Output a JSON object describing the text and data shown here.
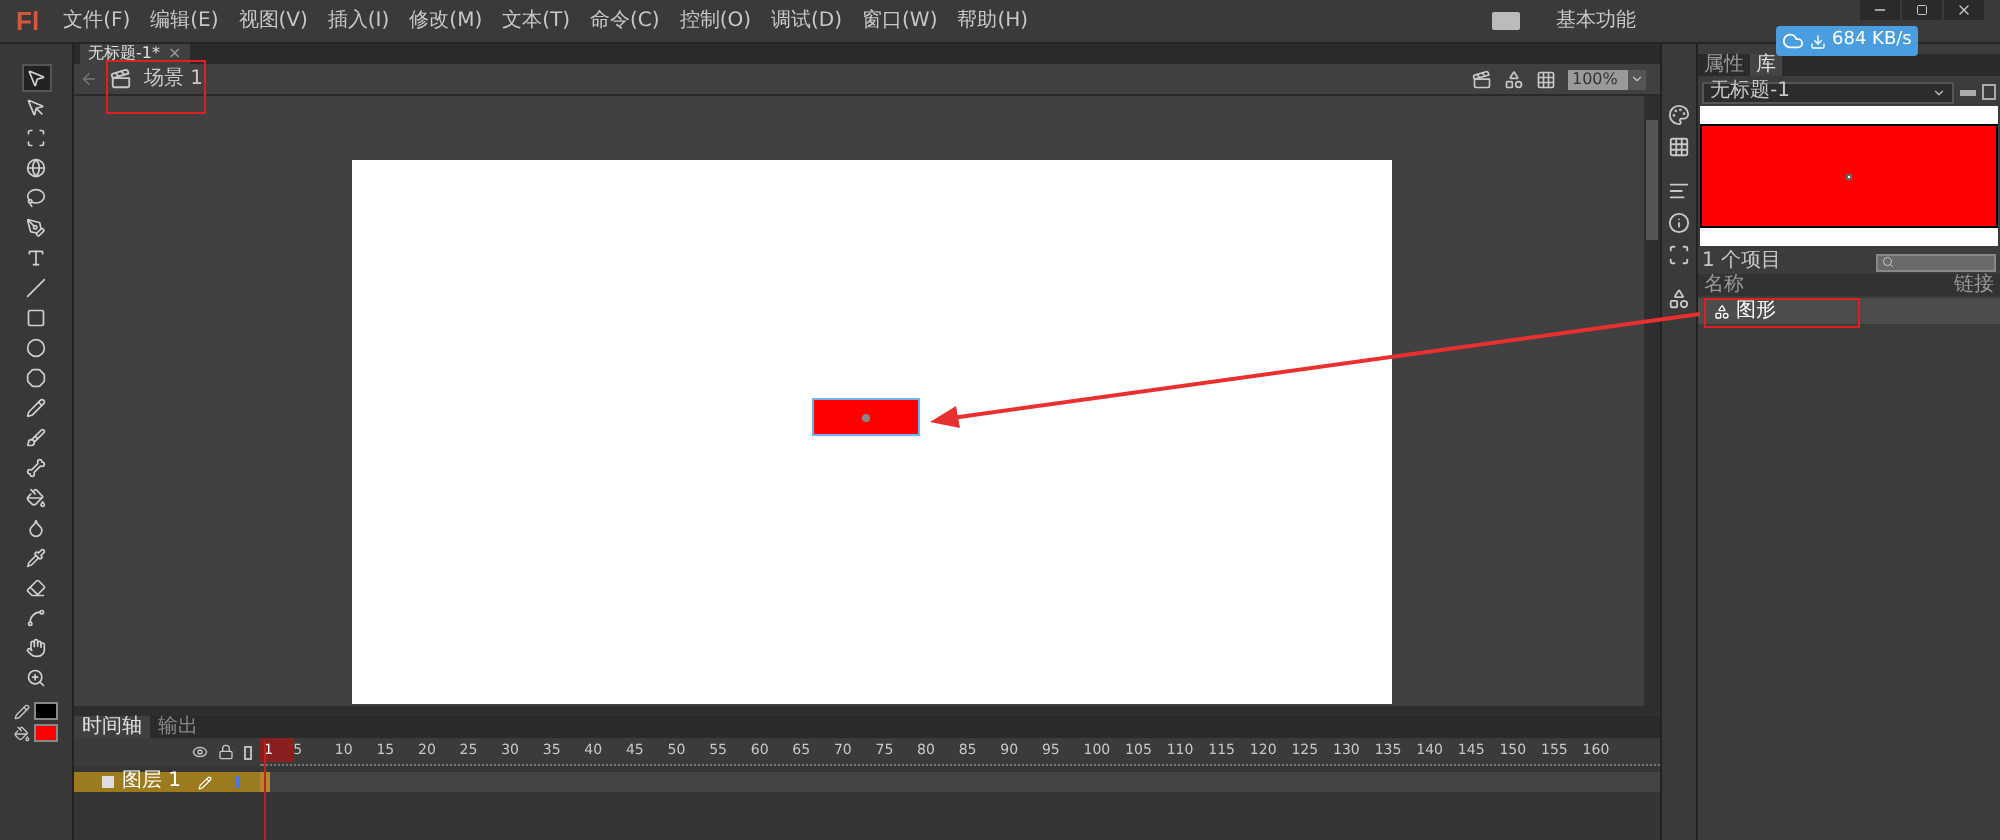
{
  "menu_bar": {
    "logo": "Fl",
    "items": [
      "文件(F)",
      "编辑(E)",
      "视图(V)",
      "插入(I)",
      "修改(M)",
      "文本(T)",
      "命令(C)",
      "控制(O)",
      "调试(D)",
      "窗口(W)",
      "帮助(H)"
    ],
    "workspace": "基本功能"
  },
  "network_badge": {
    "speed": "684 KB/s"
  },
  "document_tab": {
    "title": "无标题-1*",
    "close": "×"
  },
  "edit_bar": {
    "scene": "场景 1",
    "zoom": "100%"
  },
  "tools": [
    {
      "kind": "select",
      "selected": true
    },
    {
      "kind": "subselect",
      "selected": false
    },
    {
      "kind": "transform",
      "selected": false
    },
    {
      "kind": "rotate3d",
      "selected": false
    },
    {
      "kind": "lasso",
      "selected": false
    },
    {
      "kind": "pen",
      "selected": false
    },
    {
      "kind": "text",
      "selected": false
    },
    {
      "kind": "line",
      "selected": false
    },
    {
      "kind": "rect",
      "selected": false
    },
    {
      "kind": "oval",
      "selected": false
    },
    {
      "kind": "polystar",
      "selected": false
    },
    {
      "kind": "pencil",
      "selected": false
    },
    {
      "kind": "brush",
      "selected": false
    },
    {
      "kind": "bone",
      "selected": false
    },
    {
      "kind": "bucket",
      "selected": false
    },
    {
      "kind": "ink",
      "selected": false
    },
    {
      "kind": "eyedropper",
      "selected": false
    },
    {
      "kind": "eraser",
      "selected": false
    },
    {
      "kind": "width",
      "selected": false
    },
    {
      "kind": "hand",
      "selected": false
    },
    {
      "kind": "zoom",
      "selected": false
    }
  ],
  "swatches": [
    {
      "kind": "stroke",
      "color": "#000000"
    },
    {
      "kind": "fill",
      "color": "#ff0000"
    }
  ],
  "stage": {
    "shape": {
      "color": "#ff0000",
      "selected": true
    }
  },
  "library": {
    "tabs": [
      {
        "label": "属性",
        "selected": false
      },
      {
        "label": "库",
        "selected": true
      }
    ],
    "document": "无标题-1",
    "count": "1 个项目",
    "columns": [
      "名称",
      "链接"
    ],
    "items": [
      {
        "name": "图形",
        "selected": true
      }
    ]
  },
  "timeline": {
    "tabs": [
      {
        "label": "时间轴",
        "selected": true
      },
      {
        "label": "输出",
        "selected": false
      }
    ],
    "layers": [
      {
        "name": "图层 1",
        "selected": true
      }
    ],
    "ticks": [
      "1",
      "5",
      "10",
      "15",
      "20",
      "25",
      "30",
      "35",
      "40",
      "45",
      "50",
      "55",
      "60",
      "65",
      "70",
      "75",
      "80",
      "85",
      "90",
      "95",
      "100",
      "105",
      "110",
      "115",
      "120",
      "125",
      "130",
      "135",
      "140",
      "145",
      "150",
      "155",
      "160"
    ]
  }
}
